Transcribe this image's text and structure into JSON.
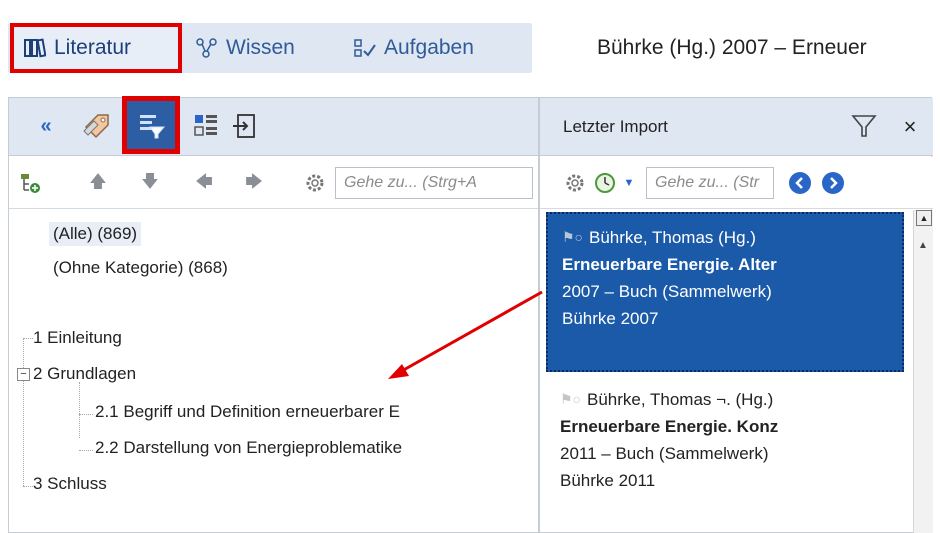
{
  "tabs": {
    "literatur": "Literatur",
    "wissen": "Wissen",
    "aufgaben": "Aufgaben"
  },
  "document_title": "Bührke (Hg.) 2007 – Erneuer",
  "toolbar": {
    "collapse_symbol": "«",
    "right_panel_label": "Letzter Import",
    "close_symbol": "×"
  },
  "left_nav": {
    "goto_placeholder": "Gehe zu... (Strg+A"
  },
  "right_nav": {
    "goto_placeholder": "Gehe zu... (Str"
  },
  "tree": {
    "all": "(Alle) (869)",
    "uncategorized": "(Ohne Kategorie) (868)",
    "items": [
      "1 Einleitung",
      "2 Grundlagen",
      "2.1 Begriff und Definition erneuerbarer E",
      "2.2 Darstellung von Energieproblematike",
      "3 Schluss"
    ],
    "expander": "−"
  },
  "references": [
    {
      "author": "Bührke, Thomas (Hg.)",
      "title": "Erneuerbare Energie. Alter",
      "year_type": "2007 – Buch (Sammelwerk)",
      "short": "Bührke 2007"
    },
    {
      "author": "Bührke, Thomas ¬. (Hg.)",
      "title": "Erneuerbare Energie. Konz",
      "year_type": "2011 – Buch (Sammelwerk)",
      "short": "Bührke 2011"
    }
  ],
  "colors": {
    "highlight_red": "#e00000",
    "selection_blue": "#1b5aa8",
    "toolbar_bg": "#dfe7f2",
    "accent_blue": "#2a66c8"
  }
}
